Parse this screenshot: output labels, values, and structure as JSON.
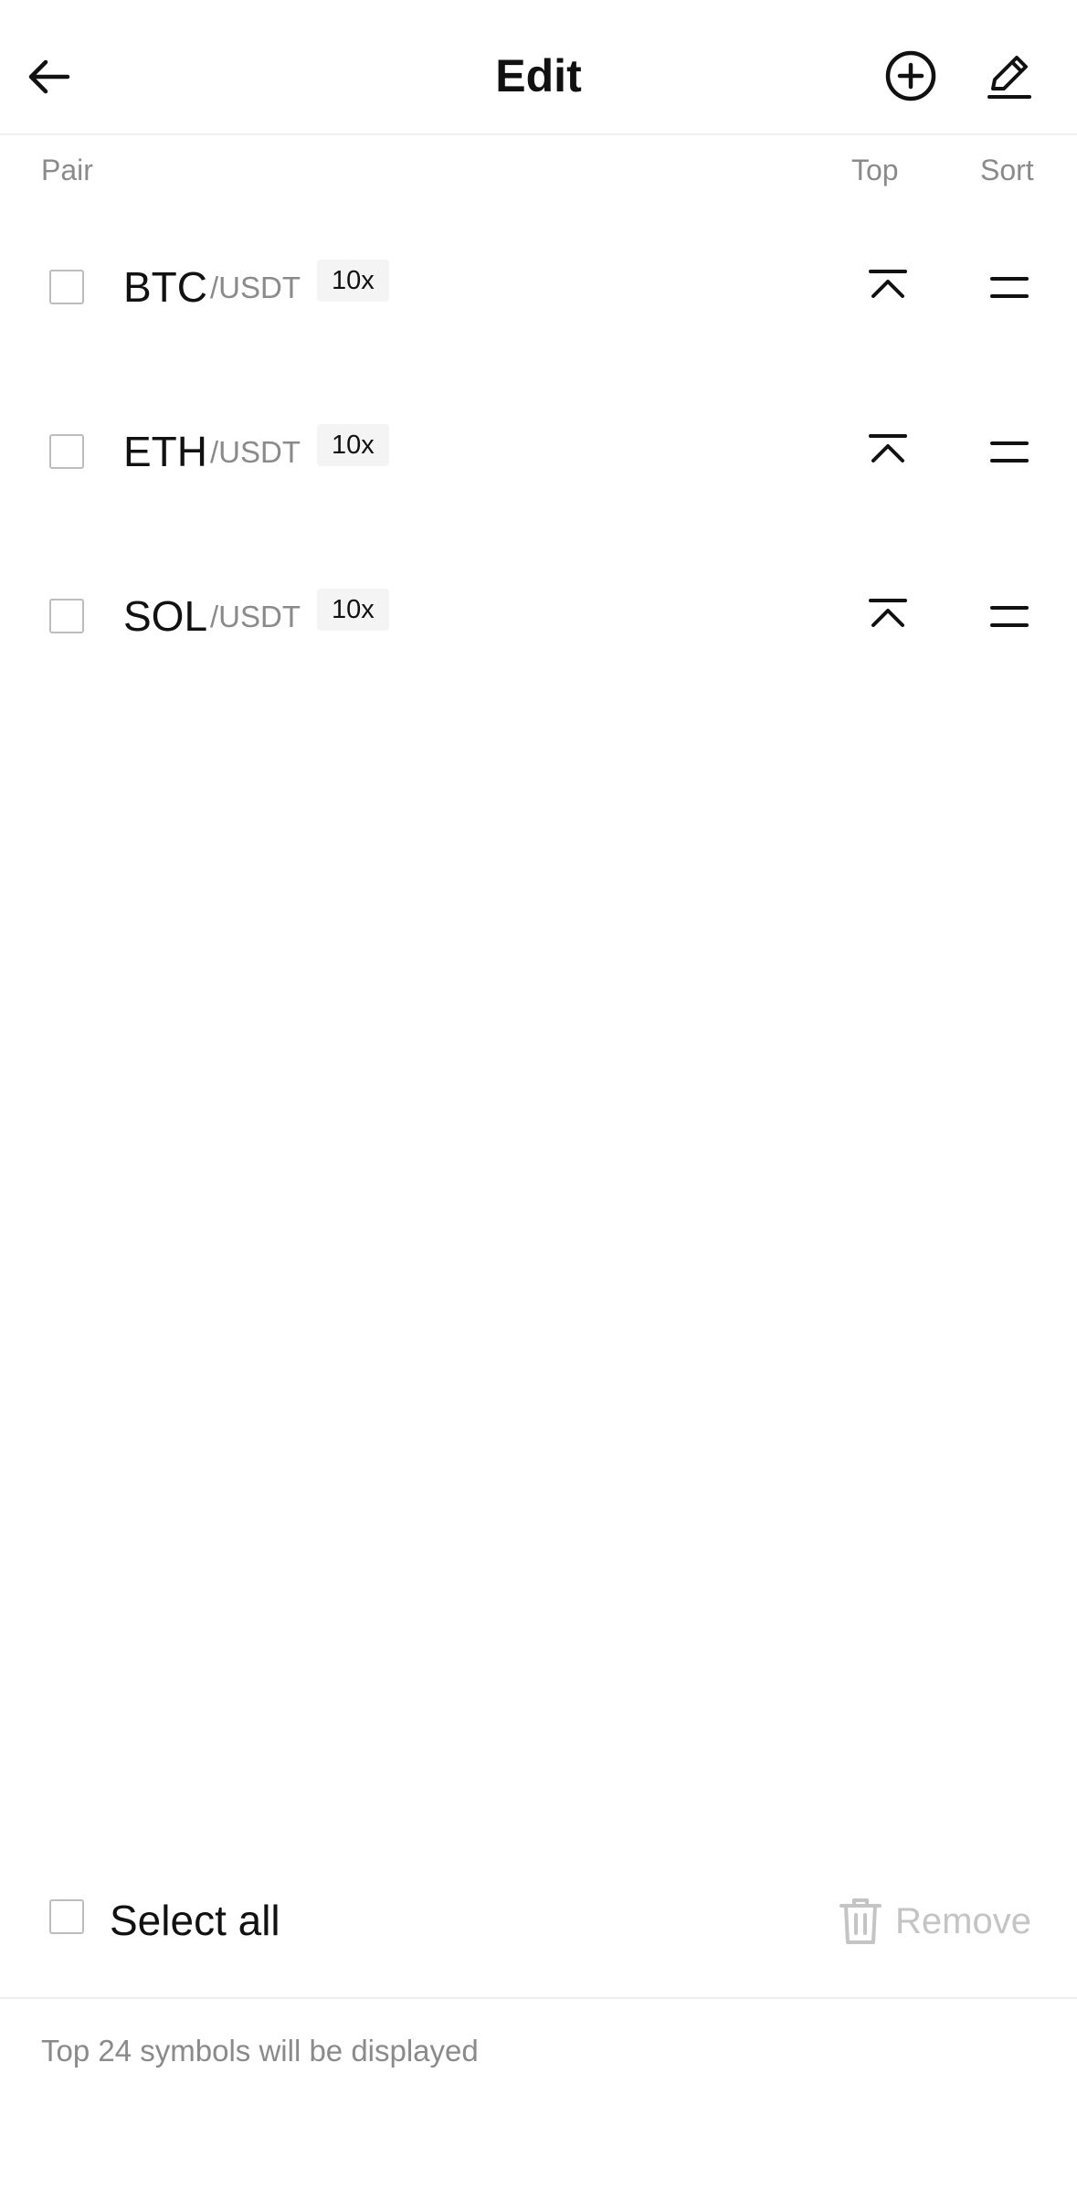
{
  "header": {
    "title": "Edit",
    "back_icon": "arrow-left-icon",
    "add_icon": "plus-circle-icon",
    "edit_icon": "pencil-icon"
  },
  "columns": {
    "pair": "Pair",
    "top": "Top",
    "sort": "Sort"
  },
  "pairs": [
    {
      "base": "BTC",
      "quote": "/USDT",
      "leverage": "10x"
    },
    {
      "base": "ETH",
      "quote": "/USDT",
      "leverage": "10x"
    },
    {
      "base": "SOL",
      "quote": "/USDT",
      "leverage": "10x"
    }
  ],
  "footer": {
    "select_all_label": "Select all",
    "remove_label": "Remove",
    "note": "Top 24 symbols will be displayed"
  },
  "colors": {
    "text": "#111111",
    "muted": "#8a8a8a",
    "disabled": "#c4c4c4",
    "badge_bg": "#f4f4f4"
  }
}
